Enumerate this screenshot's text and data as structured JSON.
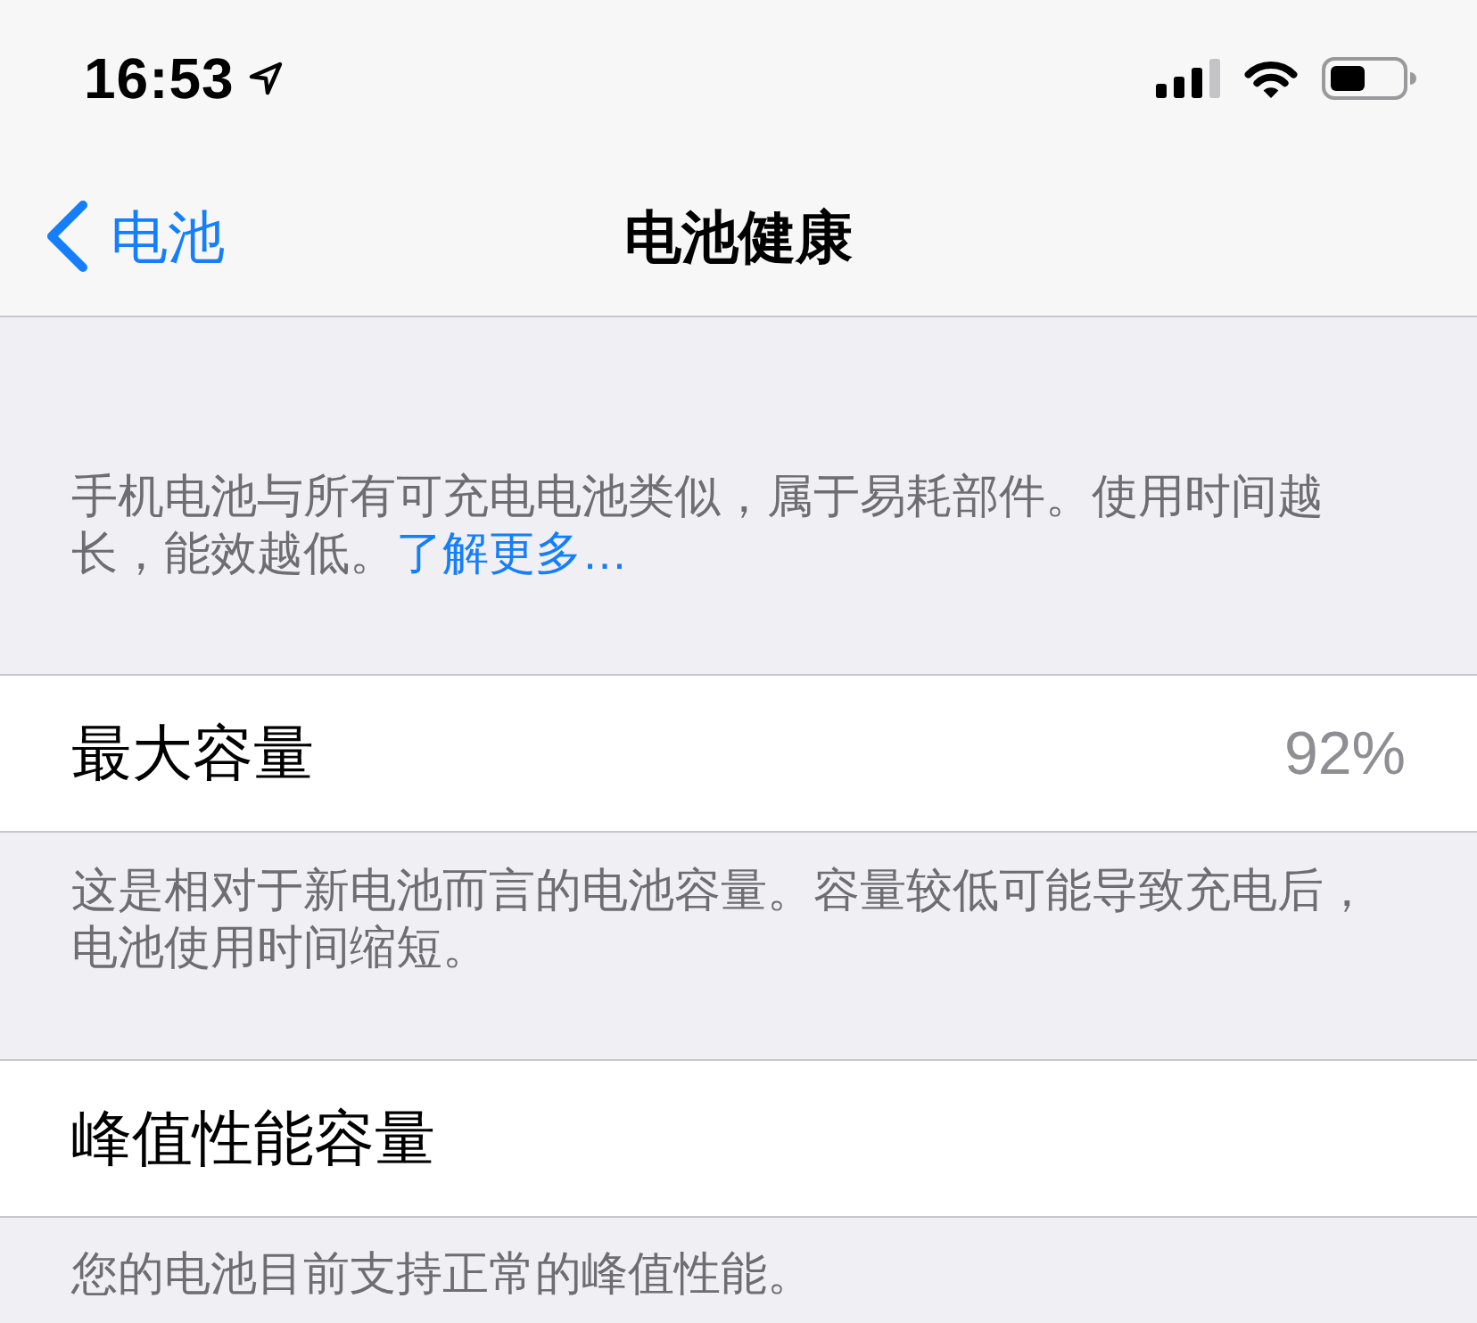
{
  "status_bar": {
    "time": "16:53"
  },
  "nav_bar": {
    "back_label": "电池",
    "title": "电池健康"
  },
  "intro": {
    "text": "手机电池与所有可充电电池类似，属于易耗部件。使用时间越长，能效越低。",
    "link": "了解更多…"
  },
  "sections": [
    {
      "label": "最大容量",
      "value": "92%",
      "footer": "这是相对于新电池而言的电池容量。容量较低可能导致充电后，电池使用时间缩短。"
    },
    {
      "label": "峰值性能容量",
      "footer": "您的电池目前支持正常的峰值性能。"
    }
  ]
}
